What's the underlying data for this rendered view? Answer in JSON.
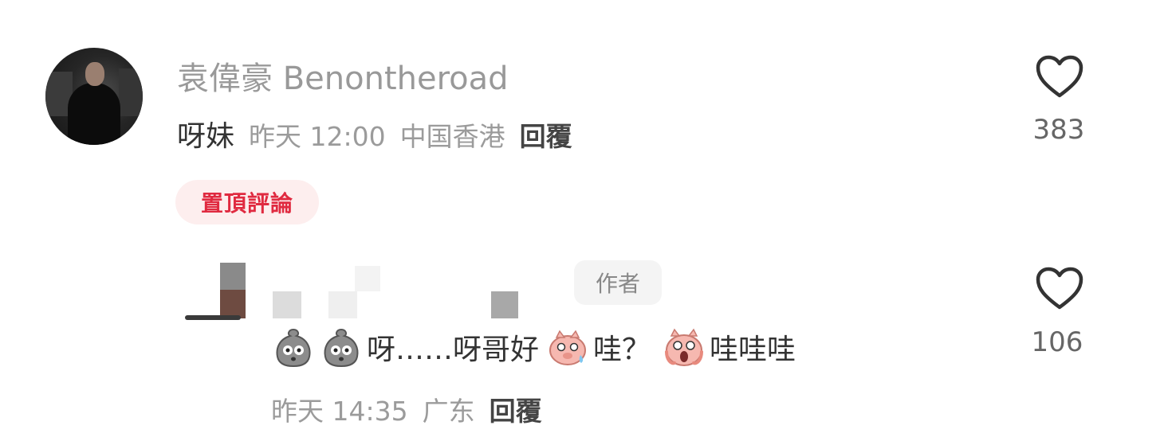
{
  "comment": {
    "username": "袁偉豪 Benontheroad",
    "text": "呀妹",
    "date": "昨天 12:00",
    "location": "中国香港",
    "reply_label": "回覆",
    "pinned_label": "置頂評論",
    "likes": "383"
  },
  "reply": {
    "author_badge": "作者",
    "text_1": "呀……呀哥好",
    "text_2": " 哇？",
    "text_3": "哇哇哇",
    "emojis": [
      "grey-bag-emoji",
      "grey-bag-emoji",
      "blushing-pig-emoji",
      "screaming-pig-emoji"
    ],
    "date": "昨天 14:35",
    "location": "广东",
    "reply_label": "回覆",
    "likes": "106"
  },
  "colors": {
    "pinned_bg": "#fdeeee",
    "pinned_text": "#e02a40",
    "meta_gray": "#9b9b9b"
  }
}
